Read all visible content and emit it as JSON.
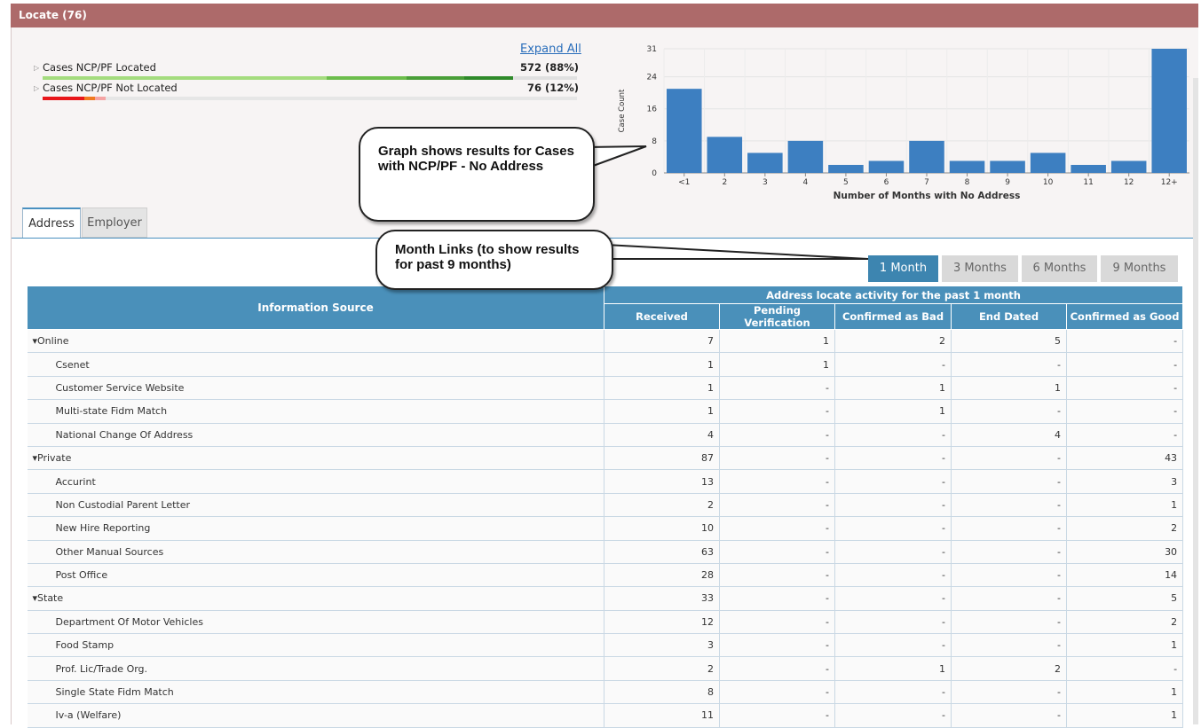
{
  "panel": {
    "title": "Locate (76)",
    "expand_all": "Expand All"
  },
  "cases": [
    {
      "label": "Cases NCP/PF Located",
      "value": "572 (88%)"
    },
    {
      "label": "Cases NCP/PF Not Located",
      "value": "76 (12%)"
    }
  ],
  "callouts": {
    "graph": "Graph shows results for Cases with NCP/PF - No Address",
    "months": "Month Links (to show results for past 9 months)"
  },
  "chart_data": {
    "type": "bar",
    "categories": [
      "<1",
      "2",
      "3",
      "4",
      "5",
      "6",
      "7",
      "8",
      "9",
      "10",
      "11",
      "12",
      "12+"
    ],
    "values": [
      21,
      9,
      5,
      8,
      2,
      3,
      8,
      3,
      3,
      5,
      2,
      3,
      31
    ],
    "ylabel": "Case Count",
    "xlabel": "Number of Months with No Address",
    "yticks": [
      0,
      8,
      16,
      24,
      31
    ],
    "ylim": [
      0,
      31
    ],
    "bar_color": "#3d7fc1"
  },
  "tabs": [
    "Address",
    "Employer"
  ],
  "month_buttons": [
    "1 Month",
    "3 Months",
    "6 Months",
    "9 Months"
  ],
  "table": {
    "source_header": "Information Source",
    "group_header": "Address locate activity for the past 1 month",
    "columns": [
      "Received",
      "Pending Verification",
      "Confirmed as Bad",
      "End Dated",
      "Confirmed as Good"
    ],
    "rows": [
      {
        "name": "▾Online",
        "type": "group",
        "cells": [
          "7",
          "1",
          "2",
          "5",
          "-"
        ]
      },
      {
        "name": "Csenet",
        "type": "sub",
        "cells": [
          "1",
          "1",
          "-",
          "-",
          "-"
        ]
      },
      {
        "name": "Customer Service Website",
        "type": "sub",
        "cells": [
          "1",
          "-",
          "1",
          "1",
          "-"
        ]
      },
      {
        "name": "Multi-state Fidm Match",
        "type": "sub",
        "cells": [
          "1",
          "-",
          "1",
          "-",
          "-"
        ]
      },
      {
        "name": "National Change Of Address",
        "type": "sub",
        "cells": [
          "4",
          "-",
          "-",
          "4",
          "-"
        ]
      },
      {
        "name": "▾Private",
        "type": "group",
        "cells": [
          "87",
          "-",
          "-",
          "-",
          "43"
        ]
      },
      {
        "name": "Accurint",
        "type": "sub",
        "cells": [
          "13",
          "-",
          "-",
          "-",
          "3"
        ]
      },
      {
        "name": "Non Custodial Parent Letter",
        "type": "sub",
        "cells": [
          "2",
          "-",
          "-",
          "-",
          "1"
        ]
      },
      {
        "name": "New Hire Reporting",
        "type": "sub",
        "cells": [
          "10",
          "-",
          "-",
          "-",
          "2"
        ]
      },
      {
        "name": "Other Manual Sources",
        "type": "sub",
        "cells": [
          "63",
          "-",
          "-",
          "-",
          "30"
        ]
      },
      {
        "name": "Post Office",
        "type": "sub",
        "cells": [
          "28",
          "-",
          "-",
          "-",
          "14"
        ]
      },
      {
        "name": "▾State",
        "type": "group",
        "cells": [
          "33",
          "-",
          "-",
          "-",
          "5"
        ]
      },
      {
        "name": "Department Of Motor Vehicles",
        "type": "sub",
        "cells": [
          "12",
          "-",
          "-",
          "-",
          "2"
        ]
      },
      {
        "name": "Food Stamp",
        "type": "sub",
        "cells": [
          "3",
          "-",
          "-",
          "-",
          "1"
        ]
      },
      {
        "name": "Prof. Lic/Trade Org.",
        "type": "sub",
        "cells": [
          "2",
          "-",
          "1",
          "2",
          "-"
        ]
      },
      {
        "name": "Single State Fidm Match",
        "type": "sub",
        "cells": [
          "8",
          "-",
          "-",
          "-",
          "1"
        ]
      },
      {
        "name": "Iv-a (Welfare)",
        "type": "sub",
        "cells": [
          "11",
          "-",
          "-",
          "-",
          "1"
        ]
      }
    ]
  }
}
